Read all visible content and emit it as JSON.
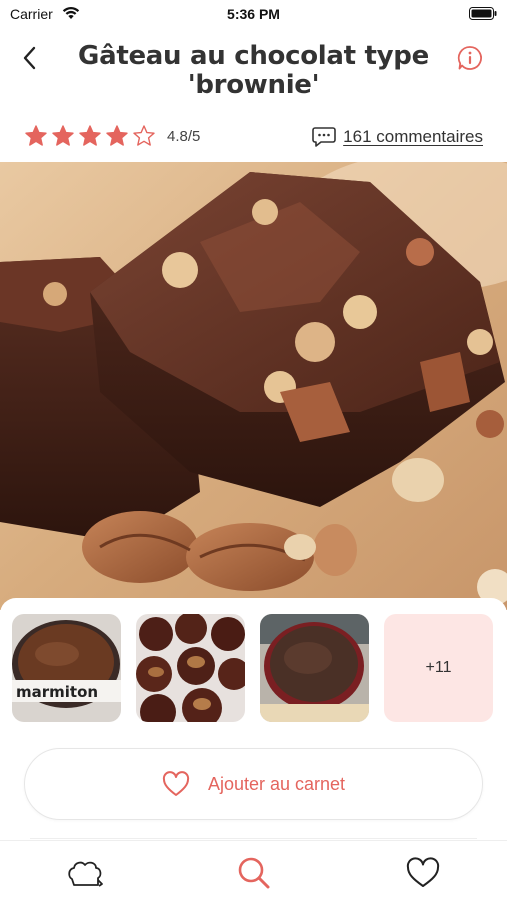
{
  "status_bar": {
    "carrier": "Carrier",
    "time": "5:36 PM"
  },
  "header": {
    "title": "Gâteau au chocolat type 'brownie'"
  },
  "rating": {
    "stars": 4,
    "max_stars": 5,
    "value_label": "4.8/5"
  },
  "comments": {
    "label": "161 commentaires"
  },
  "thumbnails": {
    "more_label": "+11",
    "watermark": "marmiton"
  },
  "add_button": {
    "label": "Ajouter au carnet"
  },
  "tab_bar": {
    "items": [
      "chef-hat-icon",
      "search-icon",
      "heart-icon"
    ],
    "active": 1
  },
  "colors": {
    "accent": "#e4655e",
    "accent_light": "#fde6e4",
    "text": "#333333"
  }
}
